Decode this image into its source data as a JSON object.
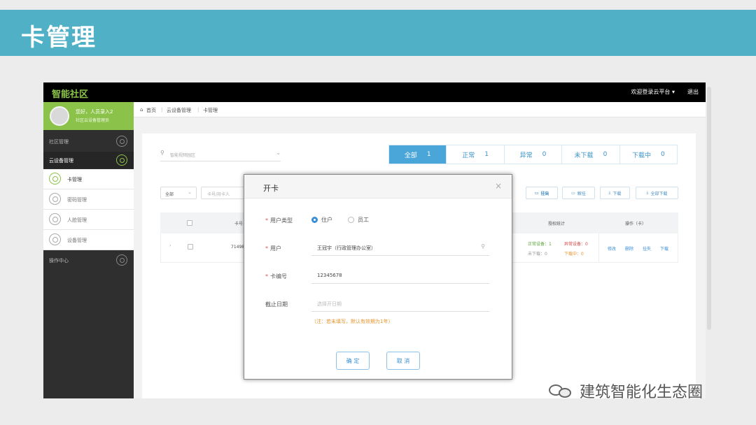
{
  "slide": {
    "title": "卡管理"
  },
  "app": {
    "brand": "智能社区",
    "topbar": {
      "welcome": "欢迎登录云平台 ▾",
      "logout": "退出"
    },
    "user": {
      "greeting": "您好，人员录入2",
      "role": "社区云设备管理员"
    },
    "sidebar": {
      "groups": [
        {
          "label": "社区管理"
        },
        {
          "label": "云设备管理"
        },
        {
          "label": "操作中心"
        }
      ],
      "subitems": [
        {
          "label": "卡管理"
        },
        {
          "label": "密码管理"
        },
        {
          "label": "人脸管理"
        },
        {
          "label": "设备管理"
        }
      ]
    },
    "breadcrumb": {
      "home_icon": "home-icon",
      "home": "首页",
      "level1": "云设备管理",
      "level2": "卡管理",
      "sep": "|"
    },
    "search": {
      "placeholder": "智能视频园区",
      "icon": "location-pin-icon"
    },
    "status_tabs": [
      {
        "label": "全部",
        "count": "1"
      },
      {
        "label": "正常",
        "count": "1"
      },
      {
        "label": "异常",
        "count": "0"
      },
      {
        "label": "未下载",
        "count": "0"
      },
      {
        "label": "下载中",
        "count": "0"
      }
    ],
    "filters": {
      "type_value": "全部",
      "input_placeholder": "卡号/持卡人"
    },
    "actions": [
      {
        "label": "导出",
        "icon": "export-icon"
      },
      {
        "label": "挂失",
        "icon": "lost-icon"
      },
      {
        "label": "解挂",
        "icon": "unlock-icon"
      },
      {
        "label": "下载",
        "icon": "download-icon"
      },
      {
        "label": "全部下载",
        "icon": "download-all-icon"
      }
    ],
    "table": {
      "headers": {
        "card": "卡号",
        "auth": "授权统计",
        "ops": "操作（卡）"
      },
      "row": {
        "card": "71498",
        "normal": "正常设备：1",
        "abnormal": "异常设备：0",
        "not_downloaded": "未下载：0",
        "downloading": "下载中：0",
        "ops": [
          "修改",
          "删除",
          "挂失",
          "下载"
        ]
      }
    },
    "modal": {
      "title": "开卡",
      "close_icon": "close-icon",
      "user_type_label": "用户类型",
      "user_type_options": [
        "住户",
        "员工"
      ],
      "user_type_selected": "住户",
      "user_label": "用户",
      "user_value": "王冠宇（行政管理办公室）",
      "card_label": "卡编号",
      "card_value": "12345678",
      "expiry_label": "截止日期",
      "expiry_placeholder": "选择开日期",
      "hint": "（注：若未填写，默认有效期为1年）",
      "confirm": "确 定",
      "cancel": "取 消"
    }
  },
  "watermark": {
    "text": "建筑智能化生态圈"
  }
}
